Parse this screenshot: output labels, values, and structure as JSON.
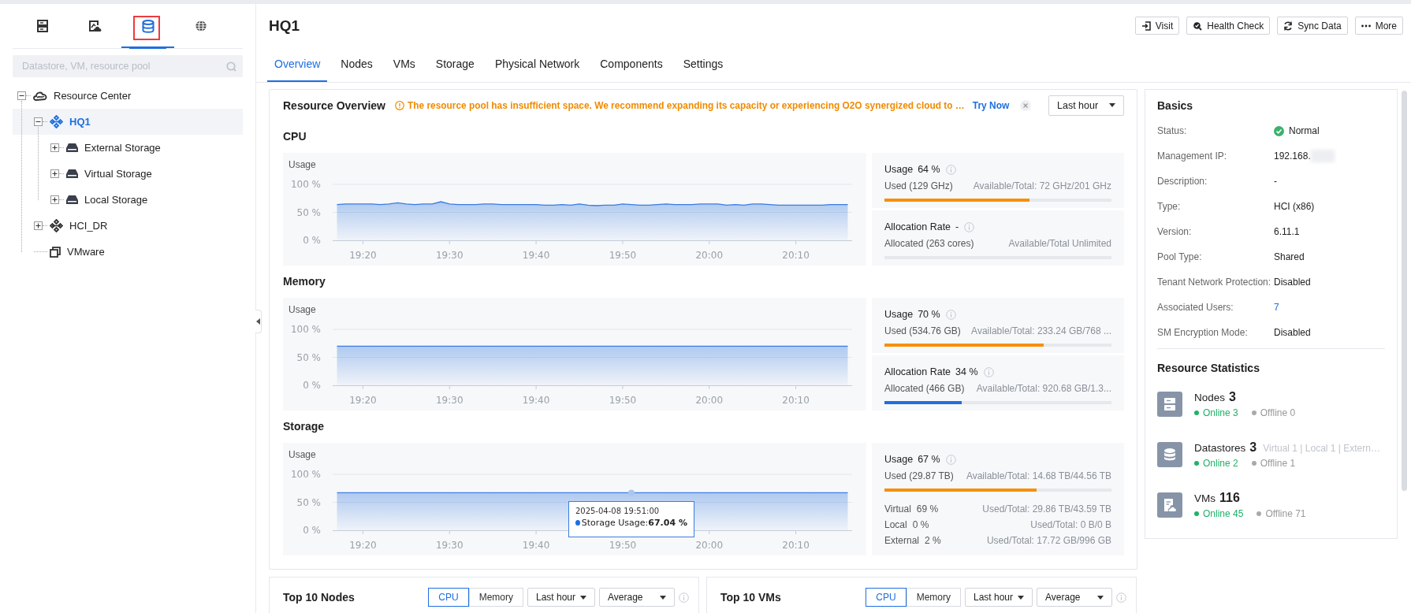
{
  "sidebar": {
    "tabs": [
      {
        "kind": "hosts",
        "selected": false,
        "marked": false
      },
      {
        "kind": "images",
        "selected": false,
        "marked": false
      },
      {
        "kind": "storage",
        "selected": true,
        "marked": true
      },
      {
        "kind": "network",
        "selected": false,
        "marked": false
      }
    ],
    "search": {
      "placeholder": "Datastore, VM, resource pool"
    },
    "tree": [
      {
        "kind": "center",
        "label": "Resource Center",
        "expanded": true,
        "selected": false,
        "children": [
          {
            "kind": "cluster",
            "label": "HQ1",
            "expanded": true,
            "selected": true,
            "children": [
              {
                "kind": "storage",
                "label": "External Storage",
                "expanded": false,
                "selected": false
              },
              {
                "kind": "storage",
                "label": "Virtual Storage",
                "expanded": false,
                "selected": false
              },
              {
                "kind": "storage",
                "label": "Local Storage",
                "expanded": false,
                "selected": false
              }
            ]
          },
          {
            "kind": "cluster",
            "label": "HCI_DR",
            "expanded": false,
            "selected": false
          },
          {
            "kind": "vmware",
            "label": "VMware",
            "selected": false
          }
        ]
      }
    ]
  },
  "header": {
    "title": "HQ1",
    "actions": [
      {
        "kind": "visit",
        "label": "Visit"
      },
      {
        "kind": "health",
        "label": "Health Check"
      },
      {
        "kind": "sync",
        "label": "Sync Data"
      },
      {
        "kind": "more",
        "label": "More"
      }
    ]
  },
  "tabs": [
    {
      "label": "Overview",
      "selected": true
    },
    {
      "label": "Nodes",
      "selected": false
    },
    {
      "label": "VMs",
      "selected": false
    },
    {
      "label": "Storage",
      "selected": false
    },
    {
      "label": "Physical Network",
      "selected": false
    },
    {
      "label": "Components",
      "selected": false
    },
    {
      "label": "Settings",
      "selected": false
    }
  ],
  "resource_overview": {
    "title": "Resource Overview",
    "alert": "The resource pool has insufficient space. We recommend expanding its capacity or experiencing O2O synergized cloud to …",
    "alert_link": "Try Now",
    "period": "Last hour",
    "sections": [
      {
        "title": "CPU",
        "chart_data": {
          "type": "area",
          "ylabel": "Usage",
          "ylim": [
            0,
            100
          ],
          "yticks": [
            {
              "value": 0,
              "label": "0 %"
            },
            {
              "value": 50,
              "label": "50 %"
            },
            {
              "value": 100,
              "label": "100 %"
            }
          ],
          "x": [
            null,
            null,
            null,
            "19:20",
            null,
            null,
            null,
            null,
            null,
            null,
            null,
            null,
            null,
            "19:30",
            null,
            null,
            null,
            null,
            null,
            null,
            null,
            null,
            null,
            "19:40",
            null,
            null,
            null,
            null,
            null,
            null,
            null,
            null,
            null,
            "19:50",
            null,
            null,
            null,
            null,
            null,
            null,
            null,
            null,
            null,
            "20:00",
            null,
            null,
            null,
            null,
            null,
            null,
            null,
            null,
            null,
            "20:10",
            null,
            null,
            null,
            null,
            null,
            null
          ],
          "series": [
            {
              "color": "#3a7de0",
              "values": [
                64,
                65,
                65,
                65,
                65,
                64,
                65,
                67,
                65,
                64,
                65,
                65,
                69,
                65,
                64,
                64,
                64,
                65,
                65,
                64,
                64,
                64,
                64,
                64,
                63,
                63,
                64,
                63,
                65,
                63,
                62,
                63,
                63,
                65,
                64,
                63,
                63,
                64,
                65,
                64,
                64,
                64,
                65,
                65,
                65,
                63,
                64,
                63,
                65,
                65,
                64,
                63,
                63,
                63,
                63,
                63,
                63,
                64,
                64,
                64
              ]
            }
          ]
        },
        "cards": [
          {
            "kind": "usage",
            "label": "Usage",
            "value": "64 %",
            "used": "Used (129 GHz)",
            "available": "Available/Total: 72 GHz/201 GHz",
            "level": 0.64
          },
          {
            "kind": "allocation",
            "label": "Allocation Rate",
            "value": "-",
            "used": "Allocated (263 cores)",
            "available": "Available/Total Unlimited",
            "level": 0
          }
        ]
      },
      {
        "title": "Memory",
        "chart_data": {
          "type": "area",
          "ylabel": "Usage",
          "ylim": [
            0,
            100
          ],
          "yticks": [
            {
              "value": 0,
              "label": "0 %"
            },
            {
              "value": 50,
              "label": "50 %"
            },
            {
              "value": 100,
              "label": "100 %"
            }
          ],
          "x": [
            null,
            null,
            null,
            "19:20",
            null,
            null,
            null,
            null,
            null,
            null,
            null,
            null,
            null,
            "19:30",
            null,
            null,
            null,
            null,
            null,
            null,
            null,
            null,
            null,
            "19:40",
            null,
            null,
            null,
            null,
            null,
            null,
            null,
            null,
            null,
            "19:50",
            null,
            null,
            null,
            null,
            null,
            null,
            null,
            null,
            null,
            "20:00",
            null,
            null,
            null,
            null,
            null,
            null,
            null,
            null,
            null,
            "20:10",
            null,
            null,
            null,
            null,
            null,
            null
          ],
          "series": [
            {
              "color": "#3a7de0",
              "values": [
                70,
                70,
                70,
                70,
                70,
                70,
                70,
                70,
                70,
                70,
                70,
                70,
                70,
                70,
                70,
                70,
                70,
                70,
                70,
                70,
                70,
                70,
                70,
                70,
                70,
                70,
                70,
                70,
                70,
                70,
                70,
                70,
                70,
                70,
                70,
                70,
                70,
                70,
                70,
                70,
                70,
                70,
                70,
                70,
                70,
                70,
                70,
                70,
                70,
                70,
                70,
                70,
                70,
                70,
                70,
                70,
                70,
                70,
                70,
                70
              ]
            }
          ]
        },
        "cards": [
          {
            "kind": "usage",
            "label": "Usage",
            "value": "70 %",
            "used": "Used (534.76 GB)",
            "available": "Available/Total: 233.24 GB/768 ...",
            "level": 0.7
          },
          {
            "kind": "allocation",
            "label": "Allocation Rate",
            "value": "34 %",
            "used": "Allocated (466 GB)",
            "available": "Available/Total: 920.68 GB/1.3...",
            "level": 0.34
          }
        ]
      },
      {
        "title": "Storage",
        "chart_data": {
          "type": "area",
          "ylabel": "Usage",
          "ylim": [
            0,
            100
          ],
          "yticks": [
            {
              "value": 0,
              "label": "0 %"
            },
            {
              "value": 50,
              "label": "50 %"
            },
            {
              "value": 100,
              "label": "100 %"
            }
          ],
          "x": [
            null,
            null,
            null,
            "19:20",
            null,
            null,
            null,
            null,
            null,
            null,
            null,
            null,
            null,
            "19:30",
            null,
            null,
            null,
            null,
            null,
            null,
            null,
            null,
            null,
            "19:40",
            null,
            null,
            null,
            null,
            null,
            null,
            null,
            null,
            null,
            "19:50",
            null,
            null,
            null,
            null,
            null,
            null,
            null,
            null,
            null,
            "20:00",
            null,
            null,
            null,
            null,
            null,
            null,
            null,
            null,
            null,
            "20:10",
            null,
            null,
            null,
            null,
            null,
            null
          ],
          "series": [
            {
              "color": "#3a7de0",
              "values": [
                67,
                67,
                67,
                67,
                67,
                67,
                67,
                67,
                67,
                67,
                67,
                67,
                67,
                67,
                67,
                67,
                67,
                67,
                67,
                67,
                67,
                67,
                67,
                67,
                67,
                67,
                67,
                67,
                67,
                67,
                67,
                67,
                67,
                67,
                67,
                67,
                67,
                67,
                67,
                67,
                67,
                67,
                67,
                67,
                67,
                67,
                67,
                67,
                67,
                67,
                67,
                67,
                67,
                67,
                67,
                67,
                67,
                67,
                67,
                67
              ]
            }
          ]
        },
        "tooltip": {
          "title": "2025-04-08 19:51:00",
          "text": "Storage Usage:**67.04 %**"
        },
        "cards": [
          {
            "kind": "usage",
            "label": "Usage",
            "value": "67 %",
            "used": "Used (29.87 TB)",
            "available": "Available/Total: 14.68 TB/44.56 TB",
            "level": 0.67,
            "breakdown": [
              {
                "name": "Virtual",
                "value": "69 %",
                "detail": "Used/Total: 29.86 TB/43.59 TB"
              },
              {
                "name": "Local",
                "value": "0 %",
                "detail": "Used/Total: 0 B/0 B"
              },
              {
                "name": "External",
                "value": "2 %",
                "detail": "Used/Total: 17.72 GB/996 GB"
              }
            ]
          }
        ]
      }
    ]
  },
  "bottom_panels": [
    {
      "title": "Top 10 Nodes",
      "metrics": [
        {
          "label": "CPU",
          "selected": true
        },
        {
          "label": "Memory",
          "selected": false
        }
      ],
      "period": "Last hour",
      "aggregate": "Average"
    },
    {
      "title": "Top 10 VMs",
      "metrics": [
        {
          "label": "CPU",
          "selected": true
        },
        {
          "label": "Memory",
          "selected": false
        }
      ],
      "period": "Last hour",
      "aggregate": "Average"
    }
  ],
  "basics": {
    "title": "Basics",
    "fields": [
      {
        "kind": "status",
        "label": "Status:",
        "value": "Normal"
      },
      {
        "kind": "redacted",
        "label": "Management IP:",
        "value": "192.168."
      },
      {
        "kind": "text",
        "label": "Description:",
        "value": "-"
      },
      {
        "kind": "text",
        "label": "Type:",
        "value": "HCI (x86)"
      },
      {
        "kind": "text",
        "label": "Version:",
        "value": "6.11.1"
      },
      {
        "kind": "text",
        "label": "Pool Type:",
        "value": "Shared"
      },
      {
        "kind": "text",
        "label": "Tenant Network Protection:",
        "value": "Disabled"
      },
      {
        "kind": "link",
        "label": "Associated Users:",
        "value": "7"
      },
      {
        "kind": "text",
        "label": "SM Encryption Mode:",
        "value": "Disabled"
      }
    ],
    "stats_title": "Resource Statistics",
    "stats": [
      {
        "kind": "nodes",
        "label": "Nodes",
        "count": "3",
        "online": "Online 3",
        "offline": "Offline 0"
      },
      {
        "kind": "datastores",
        "label": "Datastores",
        "count": "3",
        "note": "Virtual 1 | Local 1 | Extern…",
        "online": "Online 2",
        "offline": "Offline 1"
      },
      {
        "kind": "vms",
        "label": "VMs",
        "count": "116",
        "online": "Online 45",
        "offline": "Offline 71"
      }
    ]
  }
}
